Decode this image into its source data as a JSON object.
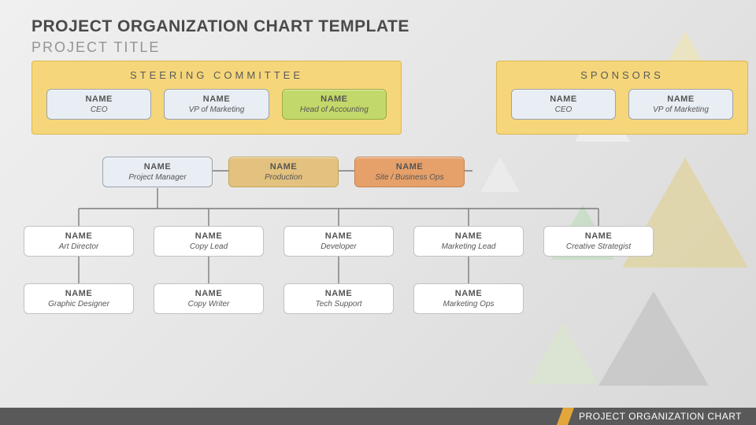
{
  "title": "PROJECT ORGANIZATION CHART TEMPLATE",
  "subtitle": "PROJECT TITLE",
  "steering": {
    "heading": "STEERING COMMITTEE",
    "members": [
      {
        "name": "NAME",
        "role": "CEO"
      },
      {
        "name": "NAME",
        "role": "VP of Marketing"
      },
      {
        "name": "NAME",
        "role": "Head of Accounting"
      }
    ]
  },
  "sponsors": {
    "heading": "SPONSORS",
    "members": [
      {
        "name": "NAME",
        "role": "CEO"
      },
      {
        "name": "NAME",
        "role": "VP of Marketing"
      }
    ]
  },
  "managers": [
    {
      "name": "NAME",
      "role": "Project Manager"
    },
    {
      "name": "NAME",
      "role": "Production"
    },
    {
      "name": "NAME",
      "role": "Site / Business Ops"
    }
  ],
  "leads": [
    {
      "name": "NAME",
      "role": "Art Director"
    },
    {
      "name": "NAME",
      "role": "Copy Lead"
    },
    {
      "name": "NAME",
      "role": "Developer"
    },
    {
      "name": "NAME",
      "role": "Marketing Lead"
    },
    {
      "name": "NAME",
      "role": "Creative Strategist"
    }
  ],
  "staff": [
    {
      "name": "NAME",
      "role": "Graphic Designer"
    },
    {
      "name": "NAME",
      "role": "Copy Writer"
    },
    {
      "name": "NAME",
      "role": "Tech Support"
    },
    {
      "name": "NAME",
      "role": "Marketing Ops"
    }
  ],
  "footer": "PROJECT ORGANIZATION CHART"
}
